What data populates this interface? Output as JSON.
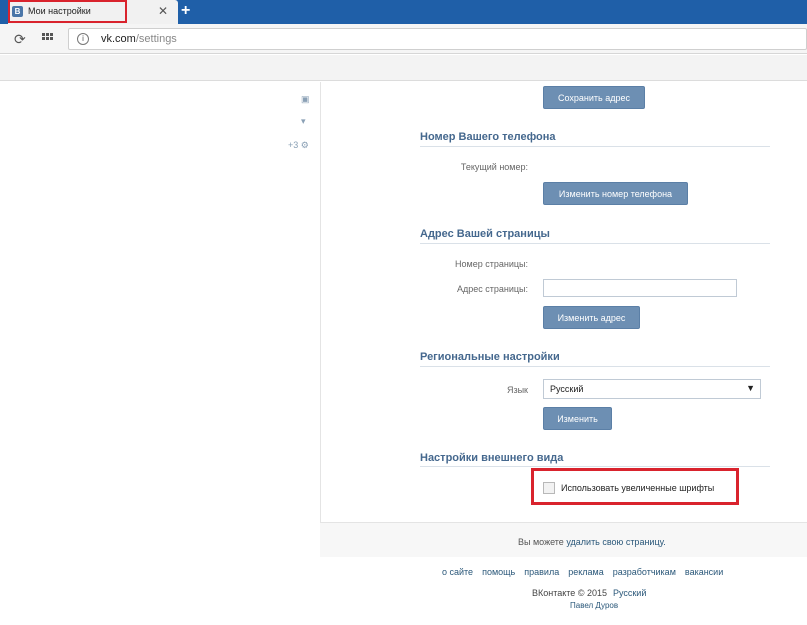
{
  "browser": {
    "tab_title": "Мои настройки",
    "tab_favicon": "В",
    "tab_close": "✕",
    "new_tab": "+",
    "url_host": "vk.com",
    "url_path": "/settings",
    "accent_color": "#d9232d"
  },
  "left_icons": [
    "chat-icon",
    "comment-icon",
    "settings-gear-icon"
  ],
  "left_counter": "+3",
  "settings": {
    "save_address_button": "Сохранить адрес",
    "phone_section": {
      "title": "Номер Вашего телефона",
      "current_number_label": "Текущий номер:",
      "change_button": "Изменить номер телефона"
    },
    "page_address_section": {
      "title": "Адрес Вашей страницы",
      "page_number_label": "Номер страницы:",
      "page_address_label": "Адрес страницы:",
      "page_address_value": "",
      "change_button": "Изменить адрес"
    },
    "regional_section": {
      "title": "Региональные настройки",
      "language_label": "Язык",
      "language_value": "Русский",
      "change_button": "Изменить"
    },
    "appearance_section": {
      "title": "Настройки внешнего вида",
      "large_fonts_label": "Использовать увеличенные шрифты",
      "large_fonts_checked": false
    },
    "delete_prefix": "Вы можете ",
    "delete_link": "удалить свою страницу."
  },
  "footer": {
    "links": [
      "о сайте",
      "помощь",
      "правила",
      "реклама",
      "разработчикам",
      "вакансии"
    ],
    "copyright": "ВКонтакте © 2015",
    "language": "Русский",
    "author": "Павел Дуров"
  }
}
